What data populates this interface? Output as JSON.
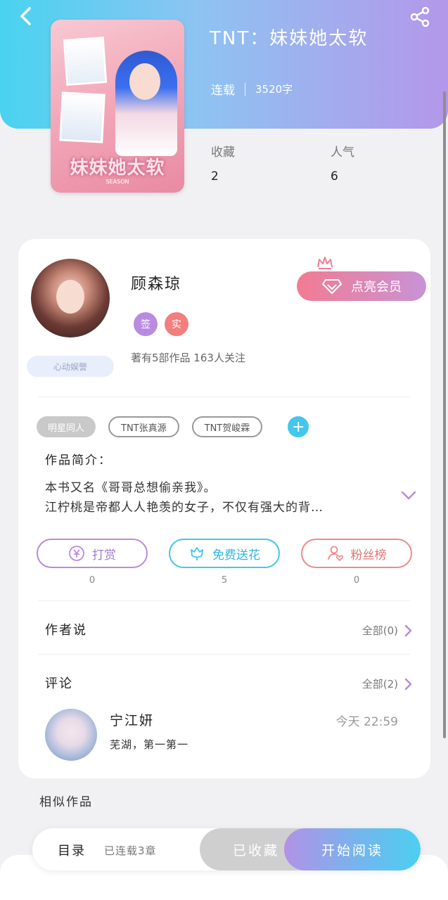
{
  "book": {
    "title": "TNT：妹妹她太软",
    "status": "连载",
    "word_count": "3520字",
    "cover_title": "妹妹她太软",
    "cover_sub": "SEASON",
    "stats": [
      {
        "label": "收藏",
        "value": "2"
      },
      {
        "label": "人气",
        "value": "6"
      }
    ]
  },
  "author": {
    "name": "顾森琼",
    "badges": [
      "签",
      "实"
    ],
    "stats_text": "著有5部作品 163人关注",
    "mood_tag": "心动娱警",
    "vip_button": "点亮会员"
  },
  "tags": {
    "items": [
      "明星同人",
      "TNT张真源",
      "TNT贺峻霖"
    ],
    "add": "+"
  },
  "intro": {
    "label": "作品简介：",
    "line1": "本书又名《哥哥总想偷亲我》。",
    "line2": "江柠桃是帝都人人艳羡的女子，不仅有强大的背…"
  },
  "actions": [
    {
      "label": "打赏",
      "count": "0"
    },
    {
      "label": "免费送花",
      "count": "5"
    },
    {
      "label": "粉丝榜",
      "count": "0"
    }
  ],
  "author_says": {
    "label": "作者说",
    "more": "全部(0)"
  },
  "comments": {
    "label": "评论",
    "more": "全部(2)",
    "items": [
      {
        "name": "宁江妍",
        "time": "今天 22:59",
        "text": "芜湖，第一第一"
      }
    ]
  },
  "similar": {
    "label": "相似作品"
  },
  "bottom_bar": {
    "toc_label": "目录",
    "toc_status": "已连载3章",
    "collected": "已收藏",
    "read": "开始阅读"
  },
  "colors": {
    "header_start": "#49d3f0",
    "header_end": "#b497ea",
    "vip_start": "#f27b92",
    "vip_end": "#c893d6",
    "reward": "#b98be0",
    "flower": "#44c6ee",
    "fans": "#ef8a8a"
  }
}
